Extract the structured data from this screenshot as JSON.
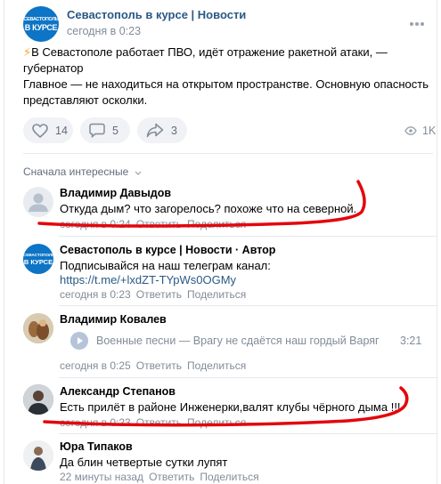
{
  "post": {
    "author": "Севастополь в курсе | Новости",
    "time": "сегодня в 0:23",
    "avatar_line1": "СЕВАСТОПОЛЬ",
    "avatar_line2": "В КУРСЕ",
    "text_line1": "В Севастополе работает ПВО, идёт отражение ракетной атаки, — губернатор",
    "text_line2": "Главное — не находиться на открытом пространстве. Основную опасность",
    "text_line3": "представляют осколки.",
    "likes": "14",
    "comments": "5",
    "shares": "3",
    "views": "1K"
  },
  "comments_header": {
    "sort_label": "Сначала интересные"
  },
  "comments": [
    {
      "name": "Владимир Давыдов",
      "text": "Откуда дым? что загорелось? похоже что на северной.",
      "time": "сегодня в 0:24",
      "reply": "Ответить",
      "share": "Поделиться"
    },
    {
      "name": "Севастополь в курсе | Новости · Автор",
      "text": "Подписывайся на наш телеграм канал:",
      "link": "https://t.me/+lxdZT-TYpWs0OGMy",
      "time": "сегодня в 0:23",
      "reply": "Ответить",
      "share": "Поделиться"
    },
    {
      "name": "Владимир Ковалев",
      "audio_title": "Военные песни",
      "audio_dash": "—",
      "audio_subtitle": "Врагу не сдаётся наш гордый Варяг",
      "audio_duration": "3:21",
      "time": "сегодня в 0:25",
      "reply": "Ответить",
      "share": "Поделиться"
    },
    {
      "name": "Александр Степанов",
      "text": "Есть прилёт в районе Инженерки,валят клубы чёрного дыма !!!",
      "time": "сегодня в 0:23",
      "reply": "Ответить",
      "share": "Поделиться"
    },
    {
      "name": "Юра Типаков",
      "text": "Да блин четвертые сутки лупят",
      "time": "22 минуты назад",
      "reply": "Ответить",
      "share": "Поделиться"
    }
  ],
  "colors": {
    "link": "#2a5885",
    "muted": "#818c99",
    "annotation": "#e3070d",
    "brand": "#0d74c6"
  },
  "icons": [
    "heart-icon",
    "comment-icon",
    "share-icon",
    "eye-icon",
    "more-icon",
    "play-icon",
    "chevron-down-icon"
  ]
}
